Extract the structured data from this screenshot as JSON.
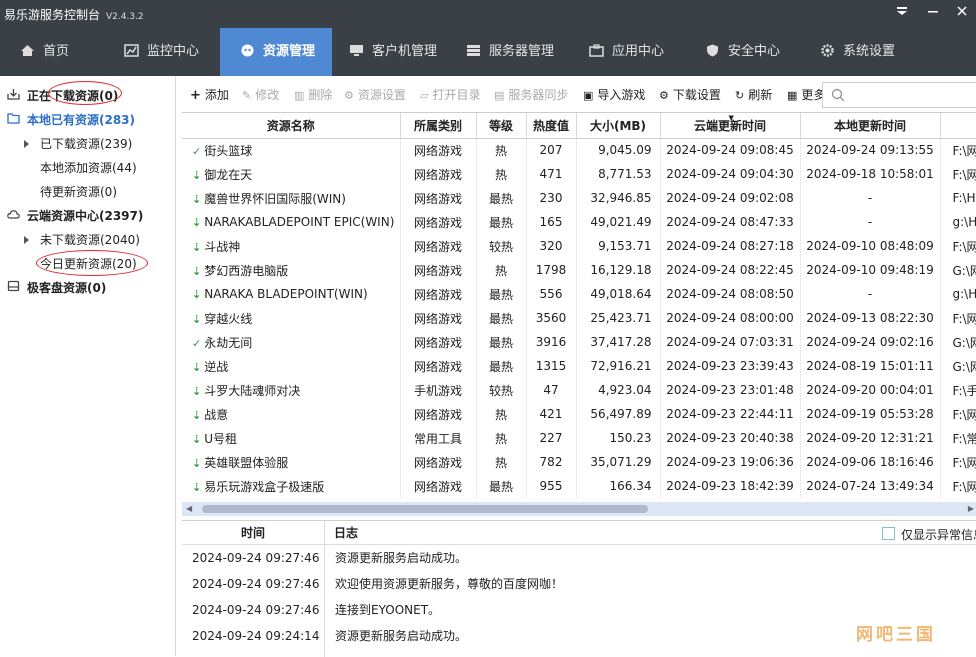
{
  "app": {
    "title": "易乐游服务控制台",
    "version": "V2.4.3.2"
  },
  "nav": [
    {
      "label": "首页",
      "icon": "home-icon",
      "active": false
    },
    {
      "label": "监控中心",
      "icon": "chart-icon",
      "active": false
    },
    {
      "label": "资源管理",
      "icon": "resource-icon",
      "active": true
    },
    {
      "label": "客户机管理",
      "icon": "monitor-icon",
      "active": false
    },
    {
      "label": "服务器管理",
      "icon": "server-icon",
      "active": false
    },
    {
      "label": "应用中心",
      "icon": "app-icon",
      "active": false
    },
    {
      "label": "安全中心",
      "icon": "shield-icon",
      "active": false
    },
    {
      "label": "系统设置",
      "icon": "gear-icon",
      "active": false
    }
  ],
  "sidebar": {
    "downloading": "正在下载资源(0)",
    "local": "本地已有资源(283)",
    "downloaded": "已下载资源(239)",
    "local_added": "本地添加资源(44)",
    "pending_update": "待更新资源(0)",
    "cloud": "云端资源中心(2397)",
    "not_downloaded": "未下载资源(2040)",
    "today_updated": "今日更新资源(20)",
    "super_disk": "极客盘资源(0)"
  },
  "toolbar": {
    "add": "添加",
    "edit": "修改",
    "delete": "删除",
    "resource_settings": "资源设置",
    "open_dir": "打开目录",
    "server_sync": "服务器同步",
    "import_game": "导入游戏",
    "download_settings": "下载设置",
    "refresh": "刷新",
    "more": "更多"
  },
  "table": {
    "headers": {
      "name": "资源名称",
      "category": "所属类别",
      "heat": "等级",
      "hot": "热度值",
      "size": "大小(MB)",
      "cloud": "云端更新时间",
      "local": "本地更新时间"
    },
    "rows": [
      {
        "status": "ok",
        "name": "街头篮球",
        "category": "网络游戏",
        "heat": "热",
        "hot": "207",
        "size": "9,045.09",
        "cloud": "2024-09-24 09:08:45",
        "local": "2024-09-24 09:13:55",
        "path": "F:\\网"
      },
      {
        "status": "dl",
        "name": "御龙在天",
        "category": "网络游戏",
        "heat": "热",
        "hot": "471",
        "size": "8,771.53",
        "cloud": "2024-09-24 09:04:30",
        "local": "2024-09-18 10:58:01",
        "path": "F:\\网"
      },
      {
        "status": "dl",
        "name": "魔兽世界怀旧国际服(WIN)",
        "category": "网络游戏",
        "heat": "最热",
        "hot": "230",
        "size": "32,946.85",
        "cloud": "2024-09-24 09:02:08",
        "local": "-",
        "path": "F:\\Ha"
      },
      {
        "status": "dl",
        "name": "NARAKABLADEPOINT EPIC(WIN)",
        "category": "网络游戏",
        "heat": "最热",
        "hot": "165",
        "size": "49,021.49",
        "cloud": "2024-09-24 08:47:33",
        "local": "-",
        "path": "g:\\Ha"
      },
      {
        "status": "dl",
        "name": "斗战神",
        "category": "网络游戏",
        "heat": "较热",
        "hot": "320",
        "size": "9,153.71",
        "cloud": "2024-09-24 08:27:18",
        "local": "2024-09-10 08:48:09",
        "path": "F:\\网"
      },
      {
        "status": "dl",
        "name": "梦幻西游电脑版",
        "category": "网络游戏",
        "heat": "热",
        "hot": "1798",
        "size": "16,129.18",
        "cloud": "2024-09-24 08:22:45",
        "local": "2024-09-10 09:48:19",
        "path": "G:\\网"
      },
      {
        "status": "dl",
        "name": "NARAKA BLADEPOINT(WIN)",
        "category": "网络游戏",
        "heat": "最热",
        "hot": "556",
        "size": "49,018.64",
        "cloud": "2024-09-24 08:08:50",
        "local": "-",
        "path": "g:\\Ha"
      },
      {
        "status": "dl",
        "name": "穿越火线",
        "category": "网络游戏",
        "heat": "最热",
        "hot": "3560",
        "size": "25,423.71",
        "cloud": "2024-09-24 08:00:00",
        "local": "2024-09-13 08:22:30",
        "path": "F:\\网"
      },
      {
        "status": "ok",
        "name": "永劫无间",
        "category": "网络游戏",
        "heat": "最热",
        "hot": "3916",
        "size": "37,417.28",
        "cloud": "2024-09-24 07:03:31",
        "local": "2024-09-24 09:02:16",
        "path": "G:\\网"
      },
      {
        "status": "dl",
        "name": "逆战",
        "category": "网络游戏",
        "heat": "最热",
        "hot": "1315",
        "size": "72,916.21",
        "cloud": "2024-09-23 23:39:43",
        "local": "2024-08-19 15:01:11",
        "path": "G:\\网"
      },
      {
        "status": "dl",
        "name": "斗罗大陆魂师对决",
        "category": "手机游戏",
        "heat": "较热",
        "hot": "47",
        "size": "4,923.04",
        "cloud": "2024-09-23 23:01:48",
        "local": "2024-09-20 00:04:01",
        "path": "F:\\手"
      },
      {
        "status": "dl",
        "name": "战意",
        "category": "网络游戏",
        "heat": "热",
        "hot": "421",
        "size": "56,497.89",
        "cloud": "2024-09-23 22:44:11",
        "local": "2024-09-19 05:53:28",
        "path": "F:\\网"
      },
      {
        "status": "dl",
        "name": "U号租",
        "category": "常用工具",
        "heat": "热",
        "hot": "227",
        "size": "150.23",
        "cloud": "2024-09-23 20:40:38",
        "local": "2024-09-20 12:31:21",
        "path": "F:\\常"
      },
      {
        "status": "dl",
        "name": "英雄联盟体验服",
        "category": "网络游戏",
        "heat": "热",
        "hot": "782",
        "size": "35,071.29",
        "cloud": "2024-09-23 19:06:36",
        "local": "2024-09-06 18:16:46",
        "path": "F:\\网"
      },
      {
        "status": "dl",
        "name": "易乐玩游戏盒子极速版",
        "category": "网络游戏",
        "heat": "最热",
        "hot": "955",
        "size": "166.34",
        "cloud": "2024-09-23 18:42:39",
        "local": "2024-07-24 13:49:34",
        "path": "F:\\网"
      }
    ]
  },
  "log": {
    "header_time": "时间",
    "header_msg": "日志",
    "error_only_label": "仅显示异常信息",
    "rows": [
      {
        "time": "2024-09-24 09:27:46",
        "msg": "资源更新服务启动成功。"
      },
      {
        "time": "2024-09-24 09:27:46",
        "msg": "欢迎使用资源更新服务，尊敬的百度网咖！"
      },
      {
        "time": "2024-09-24 09:27:46",
        "msg": "连接到EYOONET。"
      },
      {
        "time": "2024-09-24 09:24:14",
        "msg": "资源更新服务启动成功。"
      }
    ]
  },
  "watermark": "网吧三国",
  "colors": {
    "titlebar": "#3b3f46",
    "accent": "#4f89d3",
    "ok_green": "#2e9e3c",
    "circle_red": "#e0282d"
  }
}
